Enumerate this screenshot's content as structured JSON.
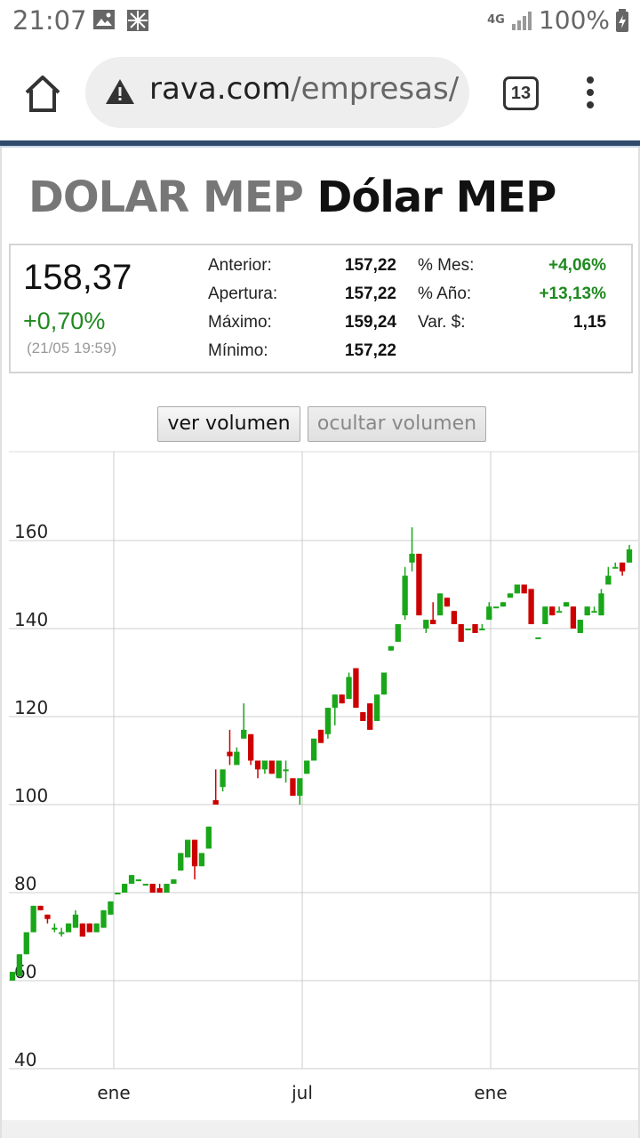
{
  "status_bar": {
    "time": "21:07",
    "network": "4G",
    "battery": "100%"
  },
  "browser": {
    "url_domain": "rava.com",
    "url_path": "/empresas/p",
    "tab_count": "13"
  },
  "page": {
    "ticker": "DOLAR MEP",
    "name": "Dólar MEP"
  },
  "quote": {
    "price": "158,37",
    "change": "+0,70%",
    "timestamp": "(21/05 19:59)",
    "stats": [
      {
        "label": "Anterior:",
        "value": "157,22"
      },
      {
        "label": "Apertura:",
        "value": "157,22"
      },
      {
        "label": "Máximo:",
        "value": "159,24"
      },
      {
        "label": "Mínimo:",
        "value": "157,22"
      }
    ],
    "stats2": [
      {
        "label": "% Mes:",
        "value": "+4,06%"
      },
      {
        "label": "% Año:",
        "value": "+13,13%"
      },
      {
        "label": "Var. $:",
        "value": "1,15"
      }
    ]
  },
  "buttons": {
    "show_volume": "ver volumen",
    "hide_volume": "ocultar volumen"
  },
  "chart_data": {
    "type": "candlestick",
    "ylim": [
      40,
      160
    ],
    "yticks": [
      "40",
      "60",
      "80",
      "100",
      "120",
      "140",
      "160"
    ],
    "xticks": [
      "ene",
      "jul",
      "ene"
    ],
    "up_color": "#1aa61a",
    "down_color": "#cc0000",
    "candles": [
      {
        "o": 60,
        "h": 62,
        "l": 60,
        "c": 62
      },
      {
        "o": 61,
        "h": 66,
        "l": 61,
        "c": 66
      },
      {
        "o": 66,
        "h": 71,
        "l": 66,
        "c": 71
      },
      {
        "o": 71,
        "h": 77,
        "l": 71,
        "c": 77
      },
      {
        "o": 77,
        "h": 77,
        "l": 76,
        "c": 76
      },
      {
        "o": 75,
        "h": 75,
        "l": 73,
        "c": 74
      },
      {
        "o": 72,
        "h": 73,
        "l": 71,
        "c": 72
      },
      {
        "o": 71,
        "h": 72,
        "l": 70,
        "c": 71
      },
      {
        "o": 71,
        "h": 73,
        "l": 71,
        "c": 73
      },
      {
        "o": 72,
        "h": 76,
        "l": 72,
        "c": 75
      },
      {
        "o": 73,
        "h": 73,
        "l": 70,
        "c": 70
      },
      {
        "o": 73,
        "h": 73,
        "l": 71,
        "c": 71
      },
      {
        "o": 71,
        "h": 73,
        "l": 71,
        "c": 73
      },
      {
        "o": 72,
        "h": 76,
        "l": 72,
        "c": 76
      },
      {
        "o": 75,
        "h": 78,
        "l": 75,
        "c": 78
      },
      {
        "o": 80,
        "h": 80,
        "l": 80,
        "c": 80
      },
      {
        "o": 80,
        "h": 82,
        "l": 80,
        "c": 82
      },
      {
        "o": 82,
        "h": 84,
        "l": 82,
        "c": 84
      },
      {
        "o": 83,
        "h": 83,
        "l": 83,
        "c": 83
      },
      {
        "o": 82,
        "h": 82,
        "l": 82,
        "c": 82
      },
      {
        "o": 82,
        "h": 82,
        "l": 80,
        "c": 80
      },
      {
        "o": 81,
        "h": 82,
        "l": 80,
        "c": 80
      },
      {
        "o": 80,
        "h": 82,
        "l": 80,
        "c": 82
      },
      {
        "o": 82,
        "h": 83,
        "l": 82,
        "c": 83
      },
      {
        "o": 85,
        "h": 89,
        "l": 85,
        "c": 89
      },
      {
        "o": 88,
        "h": 92,
        "l": 88,
        "c": 92
      },
      {
        "o": 92,
        "h": 92,
        "l": 83,
        "c": 86
      },
      {
        "o": 86,
        "h": 89,
        "l": 86,
        "c": 89
      },
      {
        "o": 90,
        "h": 95,
        "l": 90,
        "c": 95
      },
      {
        "o": 101,
        "h": 108,
        "l": 100,
        "c": 100
      },
      {
        "o": 104,
        "h": 108,
        "l": 103,
        "c": 108
      },
      {
        "o": 112,
        "h": 117,
        "l": 109,
        "c": 111
      },
      {
        "o": 109,
        "h": 113,
        "l": 109,
        "c": 112
      },
      {
        "o": 115,
        "h": 123,
        "l": 115,
        "c": 117
      },
      {
        "o": 116,
        "h": 116,
        "l": 109,
        "c": 110
      },
      {
        "o": 110,
        "h": 110,
        "l": 106,
        "c": 108
      },
      {
        "o": 108,
        "h": 110,
        "l": 107,
        "c": 110
      },
      {
        "o": 110,
        "h": 110,
        "l": 107,
        "c": 107
      },
      {
        "o": 106,
        "h": 110,
        "l": 106,
        "c": 110
      },
      {
        "o": 108,
        "h": 110,
        "l": 105,
        "c": 108
      },
      {
        "o": 106,
        "h": 106,
        "l": 102,
        "c": 102
      },
      {
        "o": 102,
        "h": 106,
        "l": 100,
        "c": 106
      },
      {
        "o": 107,
        "h": 110,
        "l": 107,
        "c": 110
      },
      {
        "o": 110,
        "h": 115,
        "l": 110,
        "c": 115
      },
      {
        "o": 117,
        "h": 117,
        "l": 114,
        "c": 114
      },
      {
        "o": 116,
        "h": 122,
        "l": 115,
        "c": 122
      },
      {
        "o": 122,
        "h": 125,
        "l": 118,
        "c": 125
      },
      {
        "o": 125,
        "h": 125,
        "l": 123,
        "c": 123
      },
      {
        "o": 124,
        "h": 130,
        "l": 124,
        "c": 129
      },
      {
        "o": 131,
        "h": 131,
        "l": 122,
        "c": 122
      },
      {
        "o": 121,
        "h": 121,
        "l": 119,
        "c": 119
      },
      {
        "o": 123,
        "h": 123,
        "l": 117,
        "c": 117
      },
      {
        "o": 119,
        "h": 125,
        "l": 119,
        "c": 125
      },
      {
        "o": 125,
        "h": 130,
        "l": 125,
        "c": 130
      },
      {
        "o": 135,
        "h": 136,
        "l": 135,
        "c": 136
      },
      {
        "o": 137,
        "h": 141,
        "l": 137,
        "c": 141
      },
      {
        "o": 143,
        "h": 154,
        "l": 142,
        "c": 152
      },
      {
        "o": 155,
        "h": 163,
        "l": 153,
        "c": 157
      },
      {
        "o": 157,
        "h": 157,
        "l": 143,
        "c": 143
      },
      {
        "o": 140,
        "h": 142,
        "l": 139,
        "c": 142
      },
      {
        "o": 142,
        "h": 146,
        "l": 141,
        "c": 141
      },
      {
        "o": 143,
        "h": 148,
        "l": 143,
        "c": 148
      },
      {
        "o": 147,
        "h": 147,
        "l": 145,
        "c": 145
      },
      {
        "o": 144,
        "h": 144,
        "l": 141,
        "c": 141
      },
      {
        "o": 141,
        "h": 141,
        "l": 137,
        "c": 137
      },
      {
        "o": 140,
        "h": 140,
        "l": 140,
        "c": 140
      },
      {
        "o": 141,
        "h": 141,
        "l": 139,
        "c": 139
      },
      {
        "o": 140,
        "h": 141,
        "l": 140,
        "c": 140
      },
      {
        "o": 142,
        "h": 146,
        "l": 142,
        "c": 145
      },
      {
        "o": 145,
        "h": 145,
        "l": 145,
        "c": 145
      },
      {
        "o": 145,
        "h": 146,
        "l": 145,
        "c": 146
      },
      {
        "o": 147,
        "h": 148,
        "l": 147,
        "c": 148
      },
      {
        "o": 148,
        "h": 150,
        "l": 148,
        "c": 150
      },
      {
        "o": 150,
        "h": 150,
        "l": 148,
        "c": 148
      },
      {
        "o": 149,
        "h": 149,
        "l": 141,
        "c": 141
      },
      {
        "o": 138,
        "h": 138,
        "l": 138,
        "c": 138
      },
      {
        "o": 141,
        "h": 145,
        "l": 141,
        "c": 145
      },
      {
        "o": 145,
        "h": 145,
        "l": 143,
        "c": 143
      },
      {
        "o": 144,
        "h": 145,
        "l": 144,
        "c": 144
      },
      {
        "o": 145,
        "h": 146,
        "l": 145,
        "c": 146
      },
      {
        "o": 145,
        "h": 145,
        "l": 140,
        "c": 140
      },
      {
        "o": 139,
        "h": 142,
        "l": 139,
        "c": 142
      },
      {
        "o": 143,
        "h": 145,
        "l": 143,
        "c": 145
      },
      {
        "o": 144,
        "h": 145,
        "l": 144,
        "c": 144
      },
      {
        "o": 143,
        "h": 149,
        "l": 143,
        "c": 148
      },
      {
        "o": 150,
        "h": 154,
        "l": 150,
        "c": 152
      },
      {
        "o": 154,
        "h": 155,
        "l": 154,
        "c": 154
      },
      {
        "o": 155,
        "h": 155,
        "l": 152,
        "c": 153
      },
      {
        "o": 155,
        "h": 159,
        "l": 155,
        "c": 158
      }
    ]
  }
}
